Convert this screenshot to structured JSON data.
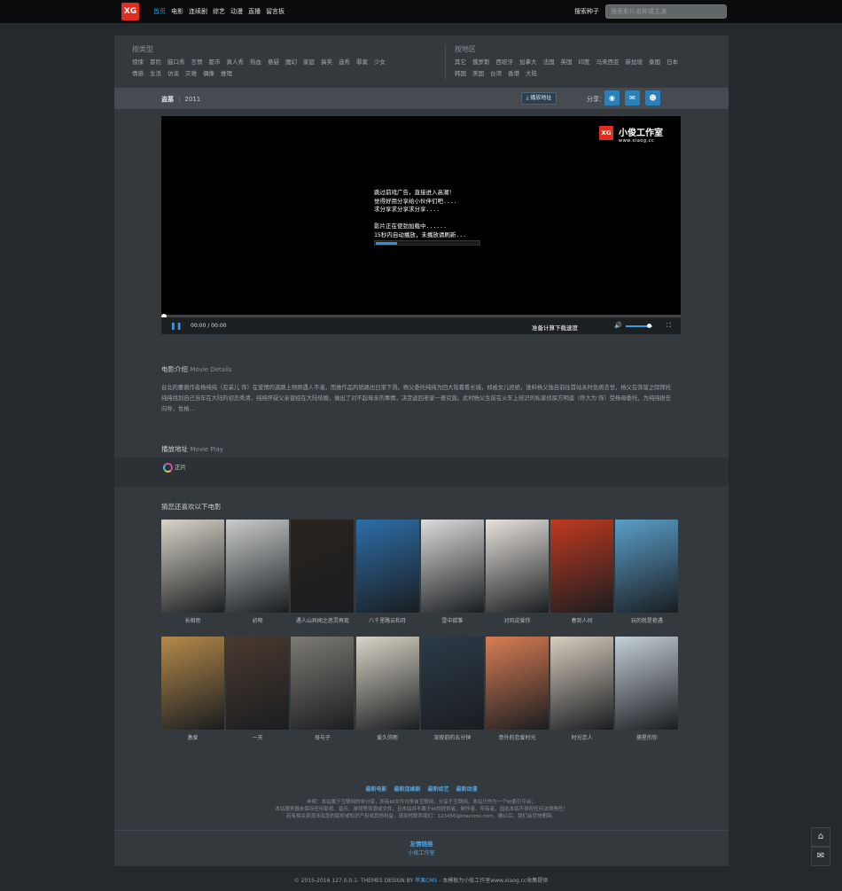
{
  "header": {
    "logo_text": "XG",
    "nav": [
      "首页",
      "电影",
      "连续剧",
      "综艺",
      "动漫",
      "直播",
      "留言板"
    ],
    "seed_search_label": "搜索种子",
    "search_placeholder": "搜索影片名称或主演"
  },
  "filter": {
    "type_title": "按类型",
    "types_row1": [
      "惊悚",
      "冒险",
      "脑口秀",
      "言情",
      "都市",
      "真人秀",
      "热血",
      "悬疑",
      "魔幻",
      "家庭",
      "搞笑",
      "选秀",
      "罪案",
      "少女"
    ],
    "types_row2": [
      "情感",
      "生活",
      "访谈",
      "灾难",
      "偶像",
      "推理"
    ],
    "region_title": "按地区",
    "regions_row1": [
      "其它",
      "俄罗斯",
      "西班牙",
      "加拿大",
      "法国",
      "英国",
      "印度",
      "马来西亚",
      "新加坡",
      "泰国",
      "日本"
    ],
    "regions_row2": [
      "韩国",
      "美国",
      "台湾",
      "香港",
      "大陆"
    ]
  },
  "infobar": {
    "title": "盗墓",
    "year": "2011",
    "download_label": "播放地址",
    "share_label": "分享："
  },
  "player": {
    "watermark": "小俊工作室",
    "watermark_url": "www.xiaog.cc",
    "message": "跳过前戏广告，直接进入高潮！\n觉得好用分享给小伙伴们吧....\n求分享求分享求分享....\n\n影片正在使劲加载中......\n15秒内自动播放，未播放请刷新...",
    "loading_progress": 0.2,
    "time_current": "00:00",
    "time_sep": "/",
    "time_total": "00:00",
    "speed_label": "准备计算下载速度",
    "volume_level": 0.85
  },
  "details": {
    "heading": "电影介绍",
    "heading_en": "Movie Details",
    "text": "台北的董酱作者杨纯纯（应采儿 饰）在爱情的道路上频频遇人不淑，而她作品的销路也日渐下滑。杨父委托纯纯为回大陆看看长城，却被女儿拒绝，谁料杨父独自前往首站关时急病去世，杨父在弥留之际拜托纯纯找到自己当年在大陆的初恋秀清，纯纯怀疑父亲曾经在大陆结婚，做出了对不起母亲的事情，决定返回老家一查究竟。此时杨父生前在火车上结识的私家侦探方明逵（佟大为 饰）受杨母委托，为纯纯担任向导，性格..."
  },
  "play": {
    "heading": "播放地址",
    "heading_en": "Movie Play",
    "source_label": "正片"
  },
  "recommend": {
    "heading": "猜您还喜欢以下电影",
    "row1": [
      {
        "title": "长相思",
        "color": "#d9d4c8"
      },
      {
        "title": "初吻",
        "color": "#c9cbcc"
      },
      {
        "title": "遇人山异闻之恶灵再现",
        "color": "#2a231d"
      },
      {
        "title": "八千里路云和月",
        "color": "#2d6ea8"
      },
      {
        "title": "雪中孤雏",
        "color": "#dcdcdc"
      },
      {
        "title": "对风说爱你",
        "color": "#e8e2dc"
      },
      {
        "title": "春到人间",
        "color": "#c0391f"
      },
      {
        "title": "玩的就是艳遇",
        "color": "#5a9fca"
      }
    ],
    "row2": [
      {
        "title": "激爱",
        "color": "#b58a4a"
      },
      {
        "title": "一天",
        "color": "#4a3a2e"
      },
      {
        "title": "母与子",
        "color": "#7d7a74"
      },
      {
        "title": "爱久弥新",
        "color": "#d9d4c6"
      },
      {
        "title": "深夜前的五分钟",
        "color": "#2c3b48"
      },
      {
        "title": "意外的恋爱时光",
        "color": "#d97d54"
      },
      {
        "title": "时光恋人",
        "color": "#d7cdbf"
      },
      {
        "title": "捕星的你",
        "color": "#c5d0d8"
      }
    ]
  },
  "footer": {
    "links": [
      "最新电影",
      "最新连续剧",
      "最新综艺",
      "最新动漫"
    ],
    "note1": "申明：本站属于互联网的非分享，所有bt文件均来自互联网，分享于互联网，本站只作为一个bt索引平台；",
    "note2": "本站服务器未保存任何影视、音乐、游戏等资源或文件，且本站并不属于bt的提供者、制作者、所有者，因此本站不承担任何法律责任！",
    "note3": "若有相关资源涉及您的版权或知识产权或其他利益，请及时联系我们：123456@maccms.com，确认后，我们会尽快删除。",
    "friend_title": "友情链接",
    "friend_link": "小俊工作室"
  },
  "copyright": {
    "prefix": "© 2015-2016 127.0.0.1- THEMES DESIGN BY",
    "designer": "苹果CMS",
    "suffix": "- 本模板为小俊工作室www.xiaog.cc收集提供"
  }
}
